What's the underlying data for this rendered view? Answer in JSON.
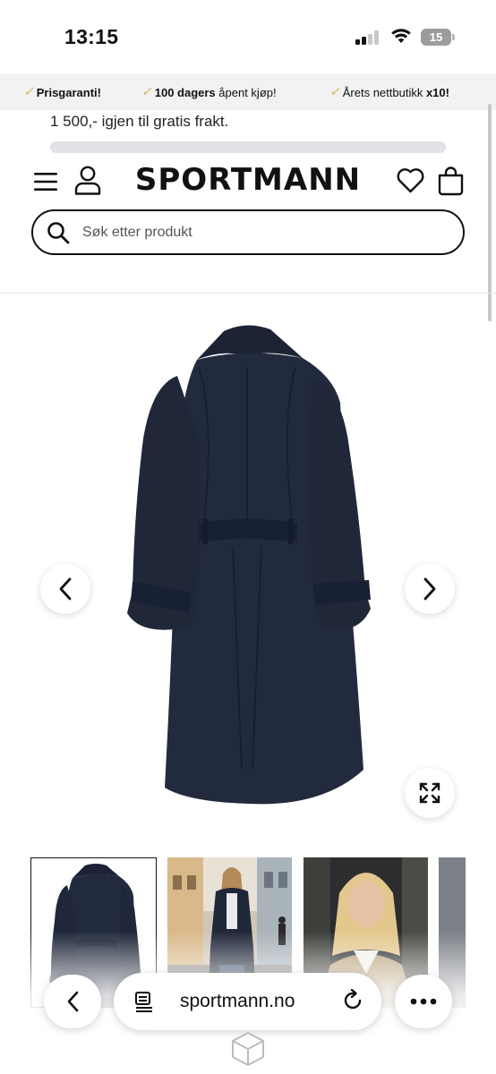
{
  "status_bar": {
    "time": "13:15",
    "battery_level": "15"
  },
  "usp_bar": {
    "items": [
      {
        "bold": "Prisgaranti!",
        "rest": ""
      },
      {
        "bold": "100 dagers",
        "rest": " åpent kjøp!"
      },
      {
        "bold": "",
        "rest": "Årets nettbutikk ",
        "bold_suffix": "x10!"
      }
    ]
  },
  "shipping": {
    "text": "1 500,- igjen til gratis frakt.",
    "progress_fraction": 0
  },
  "header": {
    "logo_text": "SPORTMANN"
  },
  "search": {
    "placeholder": "Søk etter produkt"
  },
  "gallery": {
    "icons": {
      "prev": "chevron-left-icon",
      "next": "chevron-right-icon",
      "zoom": "expand-icon"
    },
    "thumbnail_count_visible": 4,
    "selected_thumbnail": 1
  },
  "browser": {
    "url": "sportmann.no",
    "icons": {
      "back": "chevron-left-icon",
      "reader": "reader-mode-icon",
      "reload": "reload-icon",
      "more": "ellipsis-icon",
      "tabs": "tabs-icon"
    }
  },
  "colors": {
    "coat": "#1f2638",
    "usp_check": "#d9b24c",
    "usp_bg": "#f2f2f2"
  }
}
